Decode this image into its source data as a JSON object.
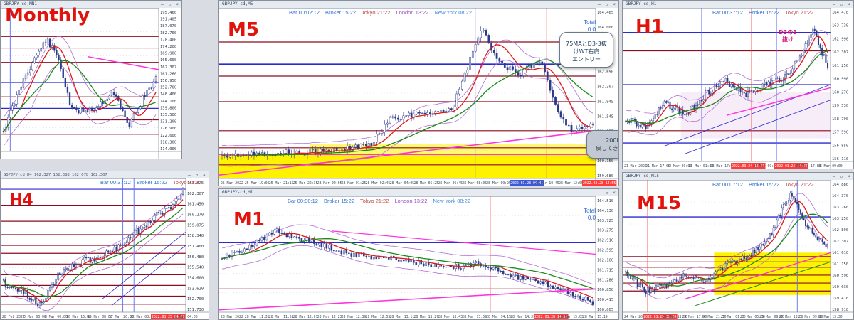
{
  "colors": {
    "timeframe_label": "#e0140c",
    "candle": "#2a3a88",
    "ma_red": "#e01818",
    "ma_green": "#1a8a1a",
    "ma_magenta": "#ff33dd",
    "band": "#b070d0",
    "level_darkred": "#8b0d1e",
    "level_blue": "#2a2ad0",
    "yellow_zone": "#fff200",
    "vline_blue": "#5a6ff0",
    "vline_red": "#ff3a3a"
  },
  "panels": {
    "monthly": {
      "label": "Monthly",
      "window_title": "GBPJPY-cd,MN1",
      "ohlc": "GBPJPY-cd,Monthly 162.307",
      "right_prices": [
        "195.460",
        "191.405",
        "187.070",
        "182.700",
        "178.400",
        "174.200",
        "169.900",
        "165.600",
        "162.307",
        "161.260",
        "156.950",
        "152.700",
        "148.400",
        "144.100",
        "139.800",
        "135.500",
        "131.200",
        "126.900",
        "122.600",
        "118.300",
        "114.000"
      ],
      "time_labels": []
    },
    "h4": {
      "label": "H4",
      "window_title": "GBPJPY-cd,H4",
      "ohlc": "GBPJPY-cd,H4 162.327 162.388 162.078 162.307",
      "bar": "Bar 00:37:12",
      "broker": "Broker 15:22",
      "tokyo": "Tokyo 21:22",
      "right_prices": [
        "163.025",
        "162.307",
        "161.450",
        "160.270",
        "159.075",
        "158.340",
        "157.400",
        "156.480",
        "155.540",
        "154.600",
        "153.620",
        "152.700",
        "151.730"
      ],
      "time_labels": [
        "28 Feb 2022",
        "3 Mar 08:00",
        "8 Mar 00:00",
        "10 Mar 16:00",
        "15 Mar 08:00",
        "17 Mar 20:00",
        "22 Mar 08:00",
        "2022.03.25 04:00",
        "28 Mar 04:00"
      ]
    },
    "m5": {
      "label": "M5",
      "window_title": "GBPJPY-cd,M5",
      "ohlc": "GBPJPY-cd,M5 162.327 162.388 162.307 162.307",
      "bar": "Bar 00:02:12",
      "broker": "Broker 15:22",
      "tokyo": "Tokyo 21:22",
      "london": "London 13:22",
      "newyork": "New York 08:22",
      "total_label": "Total",
      "total_value": "0.0",
      "right_prices": [
        "164.465",
        "164.000",
        "163.565",
        "163.000",
        "162.690",
        "162.307",
        "161.945",
        "161.545",
        "161.135",
        "160.610",
        "160.150",
        "159.680"
      ],
      "time_labels": [
        "25 Mar 2022",
        "25 Mar 19:05",
        "25 Mar 21:15",
        "25 Mar 22:35",
        "28 Mar 00:05",
        "28 Mar 01:25",
        "28 Mar 02:45",
        "28 Mar 04:05",
        "28 Mar 05:25",
        "28 Mar 06:45",
        "28 Mar 08:05",
        "28 Mar 09:25",
        "2022.03.28 09:45",
        "28 Mar 10:45",
        "28 Mar 12:05",
        "2022.03.28 14:55"
      ],
      "callout_main": "75MAとD3-3抜けWT右肩\nエントリー",
      "callout_note": "200MAを前に\n戻してきたので利確。"
    },
    "m1": {
      "label": "M1",
      "window_title": "GBPJPY-cd,M1",
      "ohlc": "GBPJPY-cd,M1 162.327 162.388 162.285 162.307",
      "bar": "Bar 00:00:12",
      "broker": "Broker 15:22",
      "tokyo": "Tokyo 21:22",
      "london": "London 13:22",
      "newyork": "New York 08:22",
      "total_label": "Total",
      "total_value": "0.0",
      "right_prices": [
        "164.510",
        "164.130",
        "163.725",
        "163.275",
        "162.910",
        "162.595",
        "162.160",
        "161.715",
        "161.280",
        "160.850",
        "160.415",
        "160.005"
      ],
      "time_labels": [
        "28 Mar 2022",
        "28 Mar 11:35",
        "28 Mar 11:51",
        "28 Mar 12:07",
        "28 Mar 12:23",
        "28 Mar 12:39",
        "28 Mar 12:55",
        "28 Mar 13:11",
        "28 Mar 13:27",
        "28 Mar 13:43",
        "28 Mar 13:59",
        "28 Mar 14:15",
        "28 Mar 14:31",
        "2022.03.28 14:55",
        "28 Mar 15:03",
        "28 Mar 15:19"
      ]
    },
    "h1": {
      "label": "H1",
      "window_title": "GBPJPY-cd,H1",
      "ohlc": "GBPJPY-cd,H1 162.755 162.078 162.307",
      "bar": "Bar 00:37:12",
      "broker": "Broker 15:22",
      "tokyo": "Tokyo 21:22",
      "pink_note": "D3の3\n抜け",
      "right_prices": [
        "164.470",
        "163.730",
        "162.990",
        "162.307",
        "161.250",
        "160.990",
        "160.270",
        "159.530",
        "158.790",
        "157.590",
        "156.850",
        "156.110"
      ],
      "time_labels": [
        "21 Mar 2022",
        "21 Mar 17:00",
        "22 Mar 09:00",
        "23 Mar 01:00",
        "23 Mar 17:00",
        "2022.03.24 12:00",
        "24 Mar 09:00",
        "2022.03.25 04:00",
        "25 Mar 17:00",
        "28 Mar 09:00"
      ]
    },
    "m15": {
      "label": "M15",
      "window_title": "GBPJPY-cd,M15",
      "ohlc": "GBPJPY-cd,M15 2.512 162.078 162.307",
      "bar": "Bar 00:07:12",
      "broker": "Broker 15:22",
      "tokyo": "Tokyo 21:22",
      "right_prices": [
        "164.880",
        "164.370",
        "163.760",
        "163.250",
        "162.890",
        "162.307",
        "161.610",
        "161.150",
        "160.590",
        "160.030",
        "159.470",
        "158.910"
      ],
      "time_labels": [
        "24 Mar 2022",
        "2022.03.25 03:00",
        "24 Mar 13:30",
        "24 Mar 17:00",
        "24 Mar 21:30",
        "25 Mar 01:00",
        "25 Mar 05:30",
        "25 Mar 09:00",
        "25 Mar 13:30",
        "28 Mar 09:00",
        "28 Mar 13:30"
      ]
    }
  }
}
